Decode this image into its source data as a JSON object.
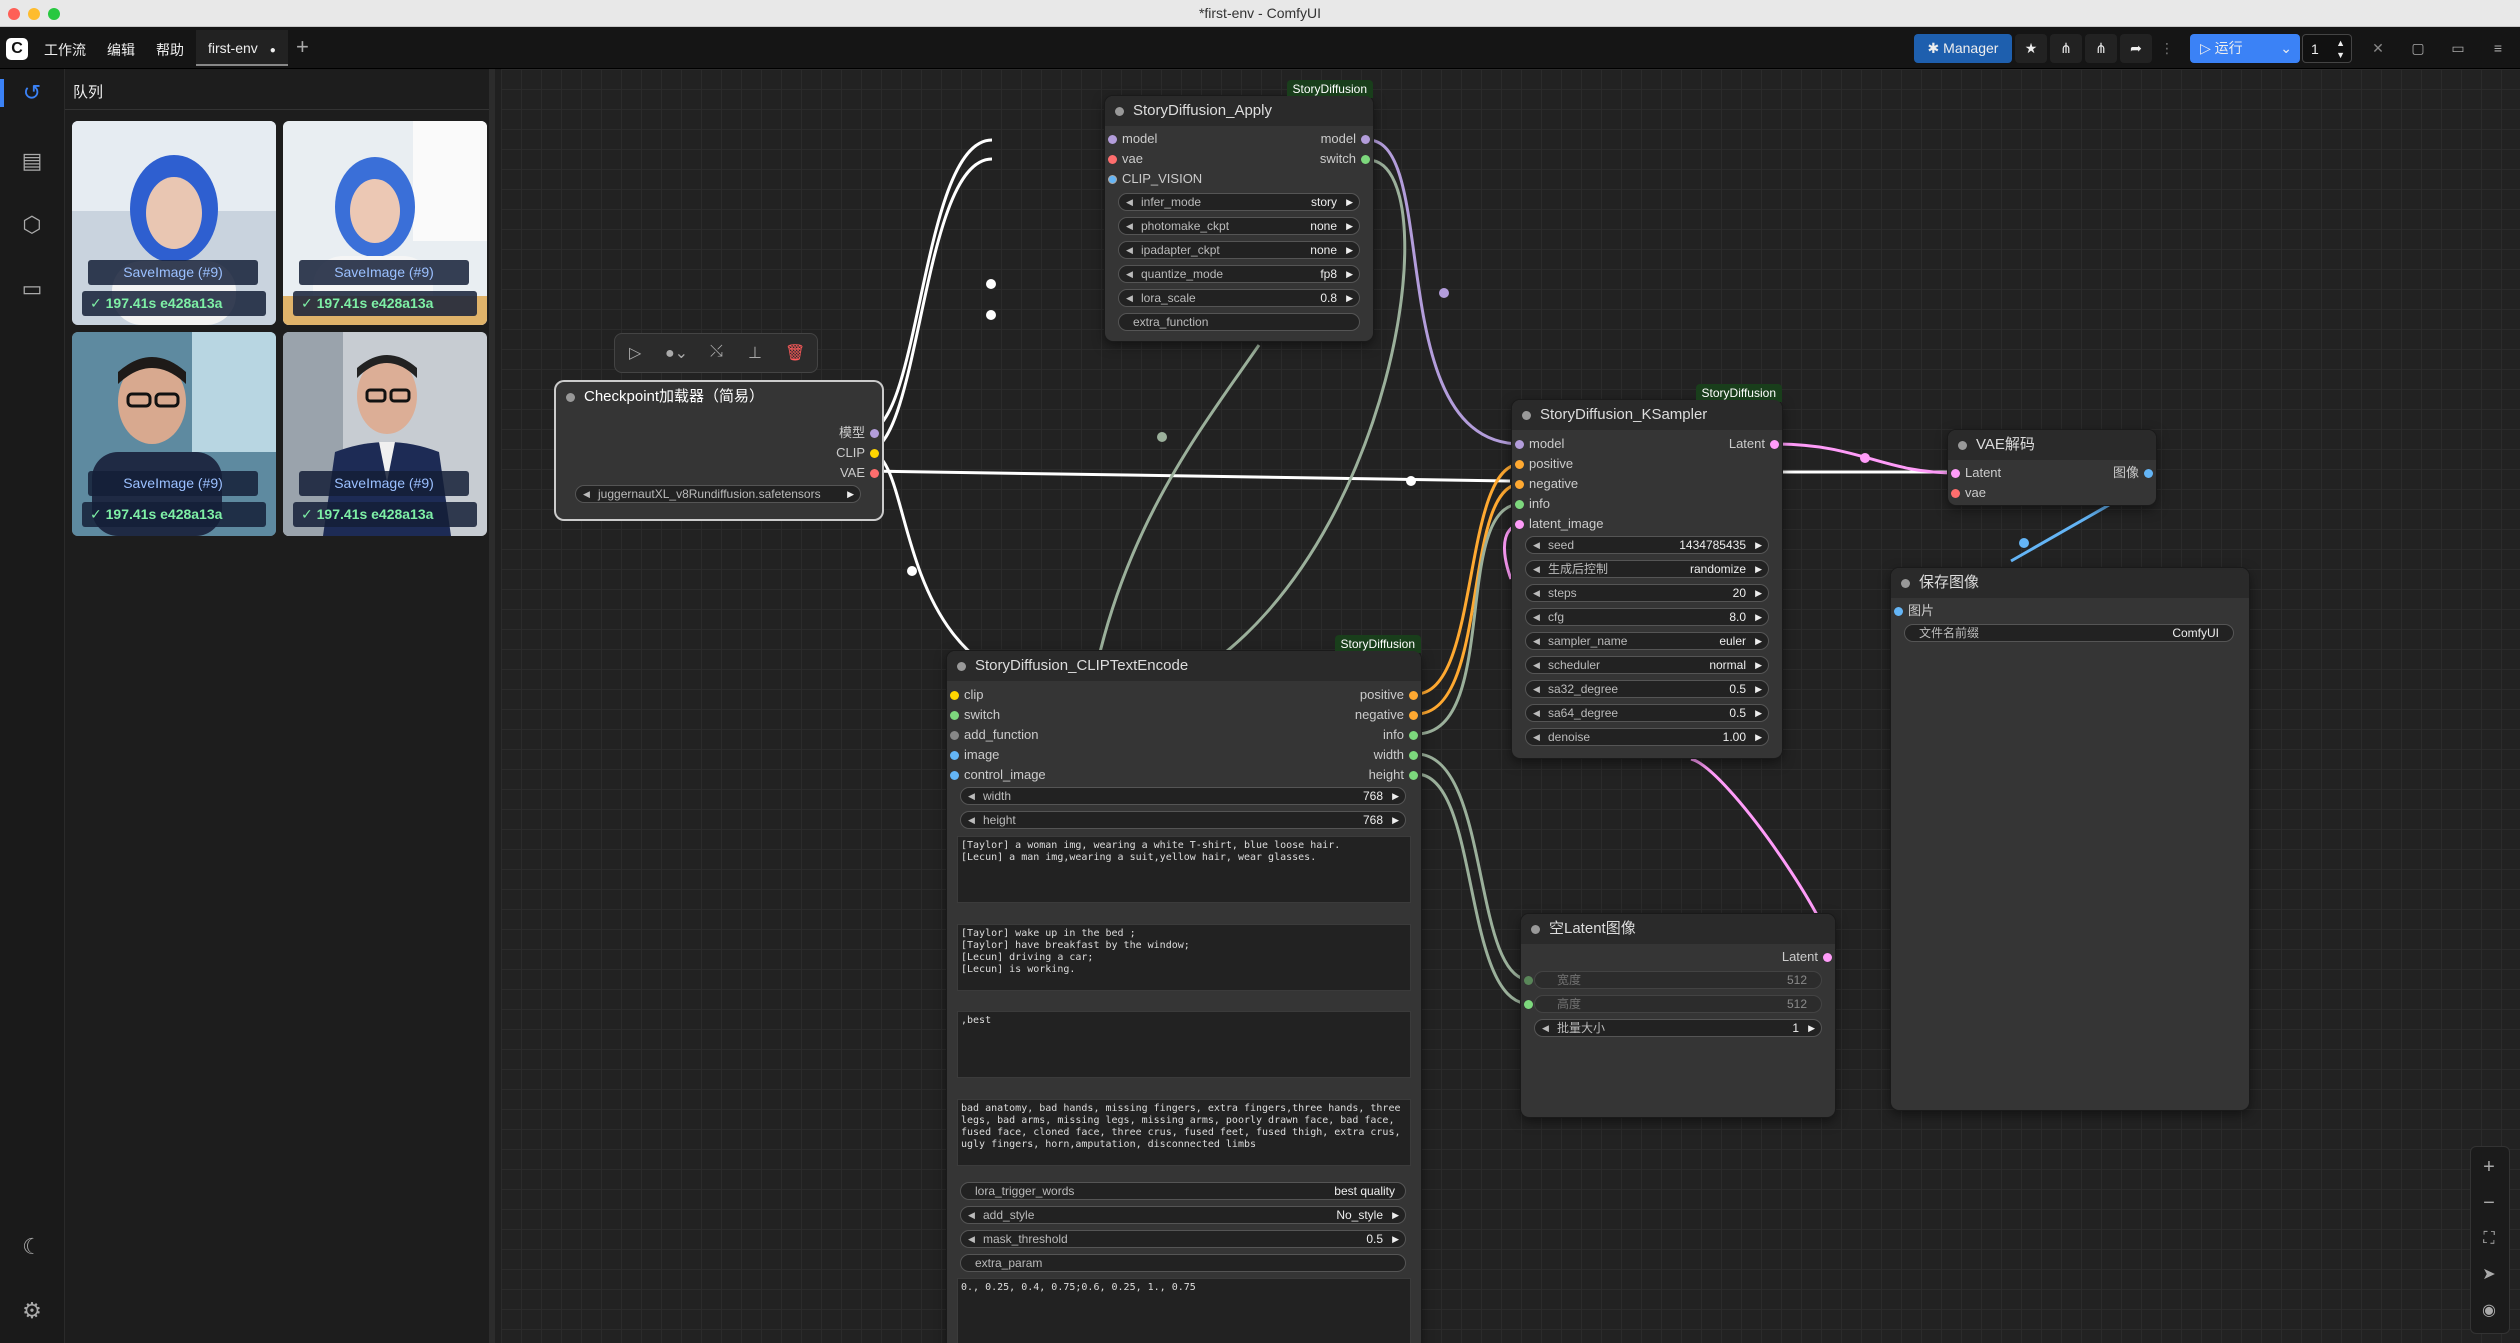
{
  "window": {
    "title": "*first-env - ComfyUI"
  },
  "menu": {
    "items": [
      "工作流",
      "编辑",
      "帮助"
    ],
    "tab": "first-env",
    "tab_dirty": "●",
    "new_tab": "+"
  },
  "toolbar": {
    "manager": "Manager",
    "run": "运行",
    "batch": "1"
  },
  "queue": {
    "title": "队列",
    "items": [
      {
        "label": "SaveImage (#9)",
        "status": "✓ 197.41s e428a13a"
      },
      {
        "label": "SaveImage (#9)",
        "status": "✓ 197.41s e428a13a"
      },
      {
        "label": "SaveImage (#9)",
        "status": "✓ 197.41s e428a13a"
      },
      {
        "label": "SaveImage (#9)",
        "status": "✓ 197.41s e428a13a"
      }
    ]
  },
  "nodes": {
    "apply": {
      "badge": "StoryDiffusion",
      "title": "StoryDiffusion_Apply",
      "inputs": [
        "model",
        "vae",
        "CLIP_VISION"
      ],
      "outputs": [
        "model",
        "switch"
      ],
      "widgets": [
        {
          "label": "infer_mode",
          "value": "story"
        },
        {
          "label": "photomake_ckpt",
          "value": "none"
        },
        {
          "label": "ipadapter_ckpt",
          "value": "none"
        },
        {
          "label": "quantize_mode",
          "value": "fp8"
        },
        {
          "label": "lora_scale",
          "value": "0.8"
        }
      ],
      "extra": "extra_function"
    },
    "ckpt": {
      "title": "Checkpoint加载器（简易）",
      "outputs": [
        "模型",
        "CLIP",
        "VAE"
      ],
      "widget": "juggernautXL_v8Rundiffusion.safetensors"
    },
    "encode": {
      "badge": "StoryDiffusion",
      "title": "StoryDiffusion_CLIPTextEncode",
      "inputs": [
        "clip",
        "switch",
        "add_function",
        "image",
        "control_image"
      ],
      "outputs": [
        "positive",
        "negative",
        "info",
        "width",
        "height"
      ],
      "widgets": [
        {
          "label": "width",
          "value": "768"
        },
        {
          "label": "height",
          "value": "768"
        }
      ],
      "text1": "[Taylor] a woman img, wearing a white T-shirt, blue loose hair.\n[Lecun] a man img,wearing a suit,yellow hair, wear glasses.",
      "text2": "[Taylor] wake up in the bed ;\n[Taylor] have breakfast by the window;\n[Lecun] driving a car;\n[Lecun] is working.",
      "text3": ",best",
      "text4": "bad anatomy, bad hands, missing fingers, extra fingers,three hands, three legs, bad arms, missing legs, missing arms, poorly drawn face, bad face, fused face, cloned face, three crus, fused feet, fused thigh, extra crus, ugly fingers, horn,amputation, disconnected limbs",
      "widgets2": [
        {
          "label": "lora_trigger_words",
          "value": "best quality"
        },
        {
          "label": "add_style",
          "value": "No_style"
        },
        {
          "label": "mask_threshold",
          "value": "0.5"
        }
      ],
      "extra": "extra_param",
      "text5": "0., 0.25, 0.4, 0.75;0.6, 0.25, 1., 0.75"
    },
    "ksampler": {
      "badge": "StoryDiffusion",
      "title": "StoryDiffusion_KSampler",
      "inputs": [
        "model",
        "positive",
        "negative",
        "info",
        "latent_image"
      ],
      "outputs": [
        "Latent"
      ],
      "widgets": [
        {
          "label": "seed",
          "value": "1434785435"
        },
        {
          "label": "生成后控制",
          "value": "randomize"
        },
        {
          "label": "steps",
          "value": "20"
        },
        {
          "label": "cfg",
          "value": "8.0"
        },
        {
          "label": "sampler_name",
          "value": "euler"
        },
        {
          "label": "scheduler",
          "value": "normal"
        },
        {
          "label": "sa32_degree",
          "value": "0.5"
        },
        {
          "label": "sa64_degree",
          "value": "0.5"
        },
        {
          "label": "denoise",
          "value": "1.00"
        }
      ]
    },
    "vae": {
      "title": "VAE解码",
      "inputs": [
        "Latent",
        "vae"
      ],
      "outputs": [
        "图像"
      ]
    },
    "save": {
      "title": "保存图像",
      "inputs": [
        "图片"
      ],
      "widget": {
        "label": "文件名前缀",
        "value": "ComfyUI"
      }
    },
    "latent": {
      "title": "空Latent图像",
      "outputs": [
        "Latent"
      ],
      "widgets": [
        {
          "label": "宽度",
          "value": "512"
        },
        {
          "label": "高度",
          "value": "512"
        },
        {
          "label": "批量大小",
          "value": "1"
        }
      ]
    }
  },
  "colors": {
    "accent": "#3b82f6",
    "manager": "#1e5fae",
    "badge": "#193e1b",
    "model": "#b39ddb",
    "clip": "#ffd500",
    "vae": "#ff6e6e",
    "latent": "#ff9cf9",
    "image": "#64b5f6",
    "conditioning": "#ffa931",
    "int": "#7dd87d"
  }
}
